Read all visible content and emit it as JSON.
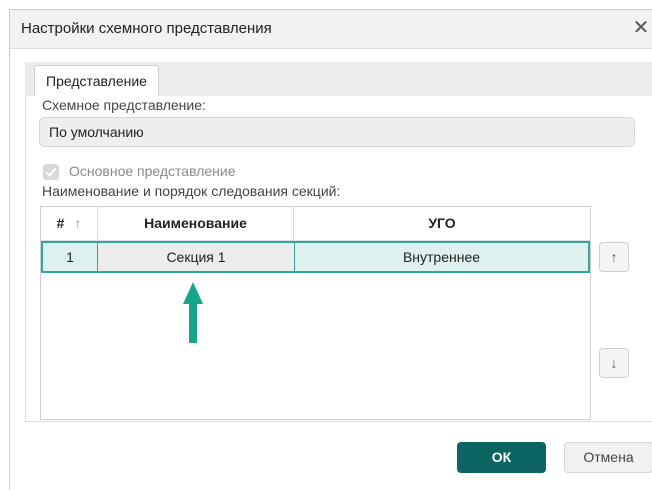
{
  "dialog": {
    "title": "Настройки схемного представления",
    "close_glyph": "✕"
  },
  "tabs": [
    {
      "label": "Представление"
    }
  ],
  "form": {
    "view_label": "Схемное представление:",
    "view_value": "По умолчанию",
    "main_view_label": "Основное представление",
    "main_view_checked": true,
    "sections_label": "Наименование и порядок следования секций:"
  },
  "table": {
    "columns": [
      {
        "label": "#",
        "sort_icon": "↑"
      },
      {
        "label": "Наименование"
      },
      {
        "label": "УГО"
      }
    ],
    "rows": [
      {
        "num": "1",
        "name": "Секция 1",
        "ugo": "Внутреннее"
      }
    ]
  },
  "side_buttons": {
    "up_glyph": "↑",
    "down_glyph": "↓"
  },
  "footer": {
    "ok_label": "ОК",
    "cancel_label": "Отмена"
  },
  "colors": {
    "accent": "#0c6563",
    "selection_border": "#2fa89b",
    "selection_fill": "#def1ef",
    "annotation_arrow": "#17a589"
  }
}
